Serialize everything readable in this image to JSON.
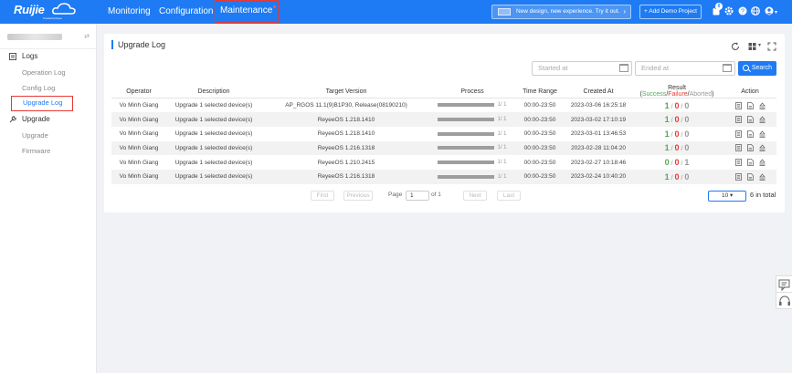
{
  "header": {
    "logo_text": "Ruijie",
    "logo_sub": "Powered by Reyee",
    "nav": [
      "Monitoring",
      "Configuration",
      "Maintenance"
    ],
    "promo_text": "New design, new experience. Try it out.",
    "demo_button": "+ Add Demo Project",
    "notification_count": "0"
  },
  "sidebar": {
    "groups": [
      {
        "label": "Logs",
        "items": [
          "Operation Log",
          "Config Log",
          "Upgrade Log"
        ]
      },
      {
        "label": "Upgrade",
        "items": [
          "Upgrade",
          "Firmware"
        ]
      }
    ],
    "active_item": "Upgrade Log"
  },
  "main": {
    "title": "Upgrade Log",
    "start_placeholder": "Started at",
    "end_placeholder": "Ended at",
    "search_label": "Search",
    "columns": [
      "Operator",
      "Description",
      "Target Version",
      "Process",
      "Time Range",
      "Created At",
      "Result (Success/Failure/Aborted)",
      "Action"
    ],
    "result_header": {
      "prefix": "Result (",
      "success": "Success",
      "failure": "Failure",
      "aborted": "Aborted",
      "suffix": ")"
    },
    "rows": [
      {
        "operator": "Vo Minh Giang",
        "description": "Upgrade 1 selected device(s)",
        "version": "AP_RGOS 11.1(9)B1P30, Release(08190210)",
        "process": "1/ 1",
        "progress": 1.0,
        "time_range": "00:00-23:50",
        "created": "2023-03-06 16:25:18",
        "success": "1",
        "failure": "0",
        "aborted": "0"
      },
      {
        "operator": "Vo Minh Giang",
        "description": "Upgrade 1 selected device(s)",
        "version": "ReyeeOS 1.218.1410",
        "process": "1/ 1",
        "progress": 1.0,
        "time_range": "00:00-23:50",
        "created": "2023-03-02 17:10:19",
        "success": "1",
        "failure": "0",
        "aborted": "0"
      },
      {
        "operator": "Vo Minh Giang",
        "description": "Upgrade 1 selected device(s)",
        "version": "ReyeeOS 1.218.1410",
        "process": "1/ 1",
        "progress": 1.0,
        "time_range": "00:00-23:50",
        "created": "2023-03-01 13:46:53",
        "success": "1",
        "failure": "0",
        "aborted": "0"
      },
      {
        "operator": "Vo Minh Giang",
        "description": "Upgrade 1 selected device(s)",
        "version": "ReyeeOS 1.216.1318",
        "process": "1/ 1",
        "progress": 1.0,
        "time_range": "00:00-23:50",
        "created": "2023-02-28 11:04:20",
        "success": "1",
        "failure": "0",
        "aborted": "0"
      },
      {
        "operator": "Vo Minh Giang",
        "description": "Upgrade 1 selected device(s)",
        "version": "ReyeeOS 1.210.2415",
        "process": "1/ 1",
        "progress": 1.0,
        "time_range": "00:00-23:50",
        "created": "2023-02-27 10:18:46",
        "success": "0",
        "failure": "0",
        "aborted": "1"
      },
      {
        "operator": "Vo Minh Giang",
        "description": "Upgrade 1 selected device(s)",
        "version": "ReyeeOS 1.216.1318",
        "process": "1/ 1",
        "progress": 1.0,
        "time_range": "00:00-23:50",
        "created": "2023-02-24 10:40:20",
        "success": "1",
        "failure": "0",
        "aborted": "0"
      }
    ],
    "pagination": {
      "first": "First",
      "previous": "Previous",
      "page_label": "Page",
      "page": "1",
      "of_label": "of 1",
      "next": "Next",
      "last": "Last",
      "page_size": "10",
      "total": "6 in total"
    }
  },
  "colors": {
    "primary": "#1e7bf3",
    "success": "#4caf50",
    "failure": "#e53935",
    "aborted": "#999999"
  }
}
